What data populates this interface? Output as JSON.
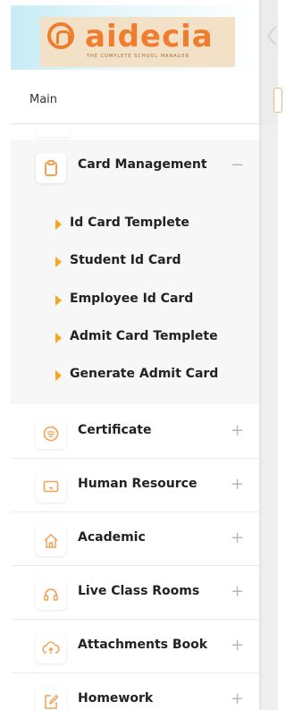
{
  "header": {
    "logo_text": "aidecia",
    "logo_tagline": "THE COMPLETE SCHOOL MANAGER"
  },
  "section": {
    "main_label": "Main"
  },
  "sidebar": {
    "card_management": {
      "label": "Card Management",
      "expanded_sign": "−",
      "subitems": [
        "Id Card Templete",
        "Student Id Card",
        "Employee Id Card",
        "Admit Card Templete",
        "Generate Admit Card"
      ]
    },
    "items": [
      {
        "label": "Certificate",
        "sign": "+"
      },
      {
        "label": "Human Resource",
        "sign": "+"
      },
      {
        "label": "Academic",
        "sign": "+"
      },
      {
        "label": "Live Class Rooms",
        "sign": "+"
      },
      {
        "label": "Attachments Book",
        "sign": "+"
      },
      {
        "label": "Homework",
        "sign": "+"
      }
    ]
  },
  "colors": {
    "accent": "#f5a623",
    "brand_orange": "#f07d2d",
    "icon_orange": "#f2a155"
  }
}
